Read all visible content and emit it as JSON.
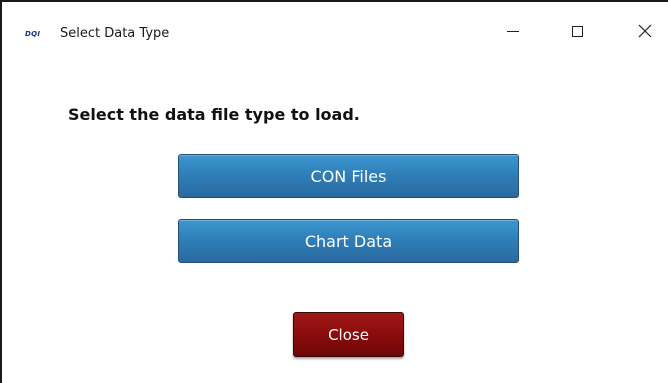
{
  "window": {
    "title": "Select Data Type",
    "app_icon": {
      "text": "DQI",
      "name": "app-logo-icon",
      "color": "#1a2f8a"
    },
    "controls": {
      "minimize": "minimize-icon",
      "maximize": "maximize-icon",
      "close": "✕"
    }
  },
  "dialog": {
    "prompt": "Select the data file type to load.",
    "buttons": {
      "con_files": "CON Files",
      "chart_data": "Chart Data",
      "close": "Close"
    }
  },
  "colors": {
    "primary_button": "#2f7fb8",
    "close_button": "#8a0c0c",
    "window_border": "#1a1a1a"
  }
}
